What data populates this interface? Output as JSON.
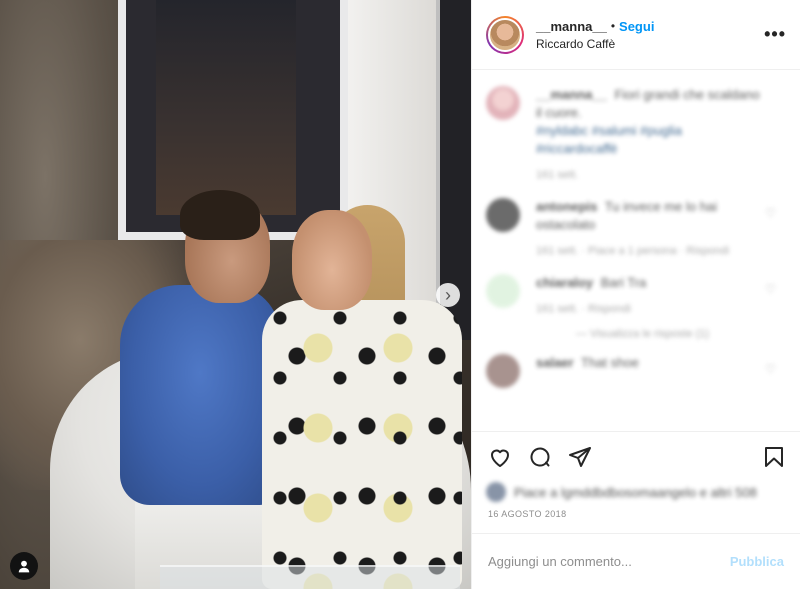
{
  "header": {
    "username": "__manna__",
    "separator": "•",
    "follow_label": "Segui",
    "location": "Riccardo Caffè",
    "more_icon": "more-horizontal-icon"
  },
  "media": {
    "next_icon": "chevron-right-icon",
    "tag_icon": "user-tag-icon",
    "next_glyph": "›"
  },
  "comments": {
    "caption": {
      "username": "__manna__",
      "text": "Fiori grandi che scaldano il cuore.",
      "tags": "#nyldabc #salumi #puglia #riccardocaffè",
      "time": "161 sett."
    },
    "items": [
      {
        "username": "antonepis",
        "text": "Tu invece me lo hai ostacolato",
        "meta": "161 sett.  ·  Piace a 1 persona  ·  Rispondi"
      },
      {
        "username": "chiaraloy",
        "text": "Bari Tra",
        "meta": "161 sett.  ·  Rispondi",
        "replies": "— Visualizza le risposte (1)"
      },
      {
        "username": "salaer",
        "text": "That shoe",
        "meta": ""
      }
    ]
  },
  "actions": {
    "like_icon": "heart-icon",
    "comment_icon": "comment-icon",
    "share_icon": "share-icon",
    "save_icon": "bookmark-icon"
  },
  "likes": {
    "text": "Piace a lgmddbdbosomaangelo e altri 508"
  },
  "date": "16 AGOSTO 2018",
  "add_comment": {
    "placeholder": "Aggiungi un commento...",
    "publish_label": "Pubblica"
  },
  "colors": {
    "accent": "#0095f6",
    "publish_disabled": "#b2dffc",
    "secondary_text": "#8e8e8e"
  }
}
